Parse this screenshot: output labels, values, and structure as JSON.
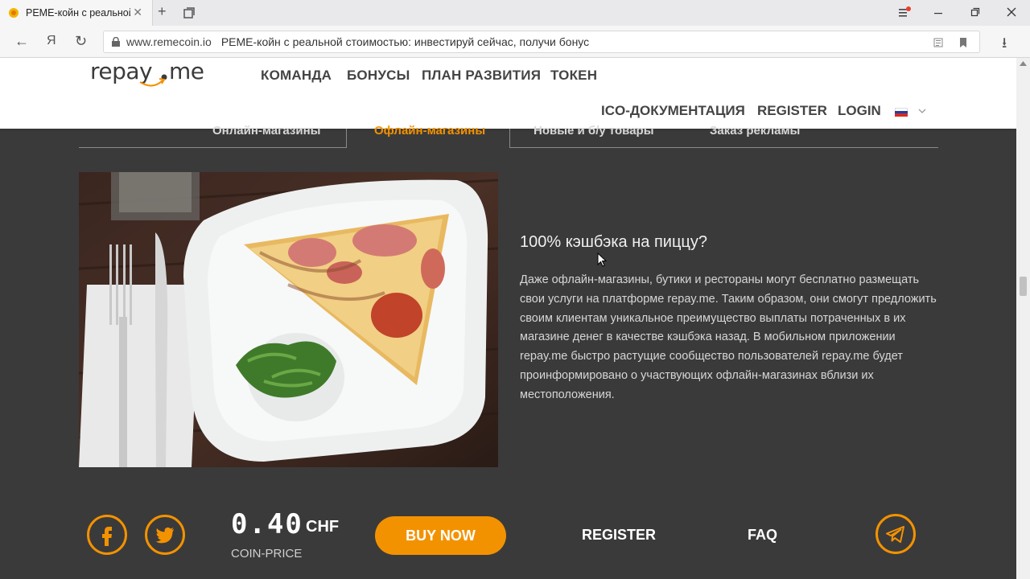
{
  "browser": {
    "tab_title": "РЕМЕ-койн с реальной",
    "tab_close": "✕",
    "new_tab": "+",
    "url_domain": "www.remecoin.io",
    "page_title": "РЕМЕ-койн с реальной стоимостью: инвестируй сейчас, получи бонус",
    "nav_back": "←",
    "nav_yandex": "Я",
    "nav_reload": "↻",
    "download": "⭳"
  },
  "site": {
    "logo": "repay.me",
    "menu_top": [
      "КОМАНДА",
      "БОНУСЫ",
      "ПЛАН РАЗВИТИЯ",
      "ТОКЕН"
    ],
    "menu_bottom": [
      "ICO-ДОКУМЕНТАЦИЯ",
      "REGISTER",
      "LOGIN"
    ],
    "language": "ru"
  },
  "categories": {
    "items": [
      "Онлайн-магазины",
      "Офлайн-магазины",
      "Новые и б/у товары",
      "Заказ рекламы"
    ],
    "active_index": 1
  },
  "content": {
    "title": "100% кэшбэка на пиццу?",
    "body": "Даже офлайн-магазины, бутики и рестораны могут бесплатно размещать свои услуги на платформе repay.me. Таким образом, они смогут предложить своим клиентам уникальное преимущество выплаты потраченных в их магазине денег в качестве кэшбэка назад. В мобильном приложении repay.me быстро растущие сообщество пользователей repay.me будет проинформировано о участвующих офлайн-магазинах вблизи их местоположения."
  },
  "footer": {
    "price": "0.40",
    "currency": "CHF",
    "price_label": "COIN-PRICE",
    "buy_label": "BUY NOW",
    "register_label": "REGISTER",
    "faq_label": "FAQ"
  },
  "colors": {
    "accent": "#f39200",
    "dark_bg": "#3a3a3a"
  }
}
